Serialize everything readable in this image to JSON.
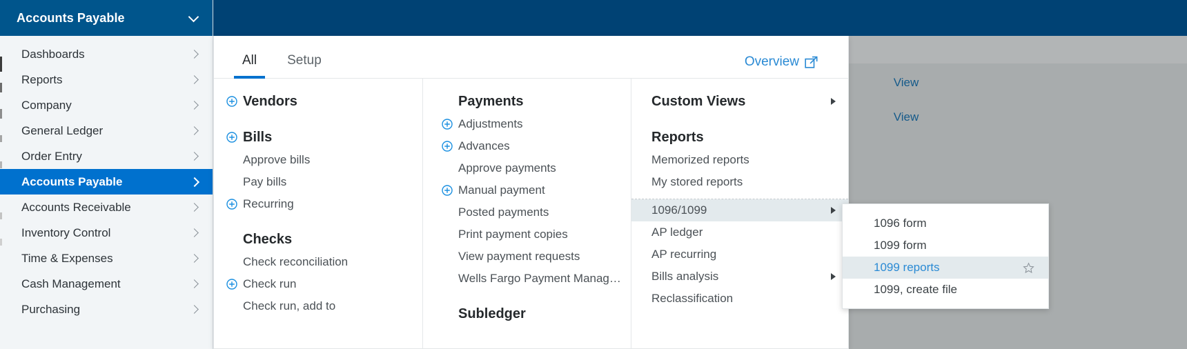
{
  "app": {
    "accent_blue": "#0071ce",
    "header_blue": "#00558c",
    "topbar_blue": "#004274",
    "link_blue": "#2a8ad4",
    "highlight_bg": "#e3eaed"
  },
  "sidebar": {
    "header_title": "Accounts Payable",
    "header_chevron_icon": "chevron-down-icon",
    "items": [
      {
        "label": "Dashboards",
        "active": false
      },
      {
        "label": "Reports",
        "active": false
      },
      {
        "label": "Company",
        "active": false
      },
      {
        "label": "General Ledger",
        "active": false
      },
      {
        "label": "Order Entry",
        "active": false
      },
      {
        "label": "Accounts Payable",
        "active": true
      },
      {
        "label": "Accounts Receivable",
        "active": false
      },
      {
        "label": "Inventory Control",
        "active": false
      },
      {
        "label": "Time & Expenses",
        "active": false
      },
      {
        "label": "Cash Management",
        "active": false
      },
      {
        "label": "Purchasing",
        "active": false
      }
    ]
  },
  "mega_menu": {
    "tabs": [
      {
        "label": "All",
        "active": true
      },
      {
        "label": "Setup",
        "active": false
      }
    ],
    "overview_link": {
      "label": "Overview",
      "icon": "external-link-icon"
    },
    "column1": {
      "groups": [
        {
          "heading": "Vendors",
          "heading_has_plus": true,
          "items": []
        },
        {
          "heading": "Bills",
          "heading_has_plus": true,
          "items": [
            {
              "label": "Approve bills",
              "plus": false
            },
            {
              "label": "Pay bills",
              "plus": false
            },
            {
              "label": "Recurring",
              "plus": true
            }
          ]
        },
        {
          "heading": "Checks",
          "heading_has_plus": false,
          "items": [
            {
              "label": "Check reconciliation",
              "plus": false
            },
            {
              "label": "Check run",
              "plus": true
            },
            {
              "label": "Check run, add to",
              "plus": false
            }
          ]
        }
      ]
    },
    "column2": {
      "groups": [
        {
          "heading": "Payments",
          "heading_has_plus": false,
          "items": [
            {
              "label": "Adjustments",
              "plus": true
            },
            {
              "label": "Advances",
              "plus": true
            },
            {
              "label": "Approve payments",
              "plus": false
            },
            {
              "label": "Manual payment",
              "plus": true
            },
            {
              "label": "Posted payments",
              "plus": false
            },
            {
              "label": "Print payment copies",
              "plus": false
            },
            {
              "label": "View payment requests",
              "plus": false
            },
            {
              "label": "Wells Fargo Payment Manag…",
              "plus": false
            }
          ]
        },
        {
          "heading": "Subledger",
          "heading_has_plus": false,
          "items": []
        }
      ]
    },
    "column3": {
      "custom_views": {
        "heading": "Custom Views",
        "submenu_icon": "triangle-right-icon"
      },
      "reports_heading": "Reports",
      "reports_top": [
        {
          "label": "Memorized reports",
          "submenu": false,
          "highlight": false
        },
        {
          "label": "My stored reports",
          "submenu": false,
          "highlight": false
        }
      ],
      "reports_bottom": [
        {
          "label": "1096/1099",
          "submenu": true,
          "highlight": true
        },
        {
          "label": "AP ledger",
          "submenu": false,
          "highlight": false
        },
        {
          "label": "AP recurring",
          "submenu": false,
          "highlight": false
        },
        {
          "label": "Bills analysis",
          "submenu": true,
          "highlight": false
        },
        {
          "label": "Reclassification",
          "submenu": false,
          "highlight": false
        }
      ]
    }
  },
  "flyout": {
    "items": [
      {
        "label": "1096 form",
        "highlight": false,
        "star": false
      },
      {
        "label": "1099 form",
        "highlight": false,
        "star": false
      },
      {
        "label": "1099 reports",
        "highlight": true,
        "star": true,
        "star_icon": "star-outline-icon"
      },
      {
        "label": "1099, create file",
        "highlight": false,
        "star": false
      }
    ]
  },
  "background_page": {
    "view_links": [
      {
        "label": "View"
      },
      {
        "label": "View"
      }
    ]
  }
}
